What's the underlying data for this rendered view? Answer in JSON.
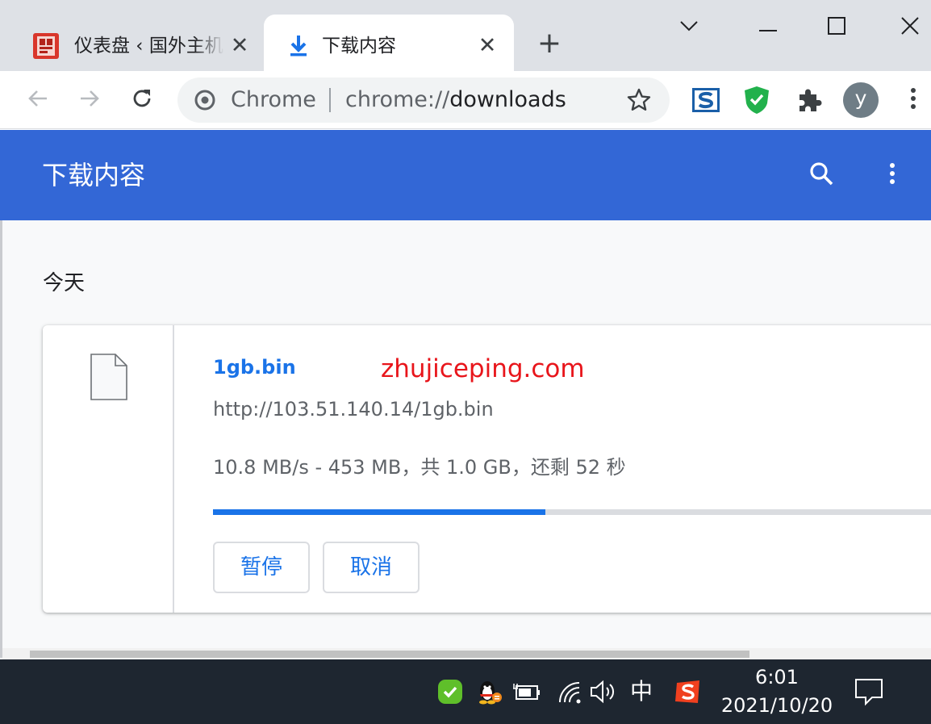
{
  "browser": {
    "tabs": [
      {
        "title": "仪表盘 ‹ 国外主机",
        "active": false
      },
      {
        "title": "下载内容",
        "active": true
      }
    ],
    "new_tab_label": "+",
    "omnibox": {
      "site_label": "Chrome",
      "url_scheme": "chrome://",
      "url_path": "downloads"
    },
    "profile_initial": "y"
  },
  "page": {
    "title": "下载内容",
    "date_group": "今天",
    "download": {
      "file_name": "1gb.bin",
      "watermark": "zhujiceping.com",
      "url": "http://103.51.140.14/1gb.bin",
      "status": "10.8 MB/s - 453 MB，共 1.0 GB，还剩 52 秒",
      "progress_fraction": 0.453,
      "pause_label": "暂停",
      "cancel_label": "取消"
    }
  },
  "taskbar": {
    "ime": "中",
    "time": "6:01",
    "date": "2021/10/20"
  },
  "colors": {
    "header_blue": "#3367d6",
    "link_blue": "#1a73e8",
    "watermark_red": "#e8151b",
    "taskbar": "#1e2630"
  },
  "icons": {
    "tab1": "wordpress-red-favicon",
    "tab2": "download-icon",
    "toolbar": [
      "back-icon",
      "forward-icon",
      "reload-icon",
      "chrome-logo-icon",
      "star-icon",
      "s-extension-icon",
      "shield-check-extension-icon",
      "puzzle-extensions-icon",
      "more-vert-icon"
    ],
    "page": [
      "search-icon",
      "more-vert-icon",
      "file-icon"
    ],
    "tray": [
      "security-check-icon",
      "qq-penguin-icon",
      "battery-plug-icon",
      "wifi-icon",
      "volume-icon",
      "sogou-ime-icon",
      "notification-icon"
    ]
  }
}
